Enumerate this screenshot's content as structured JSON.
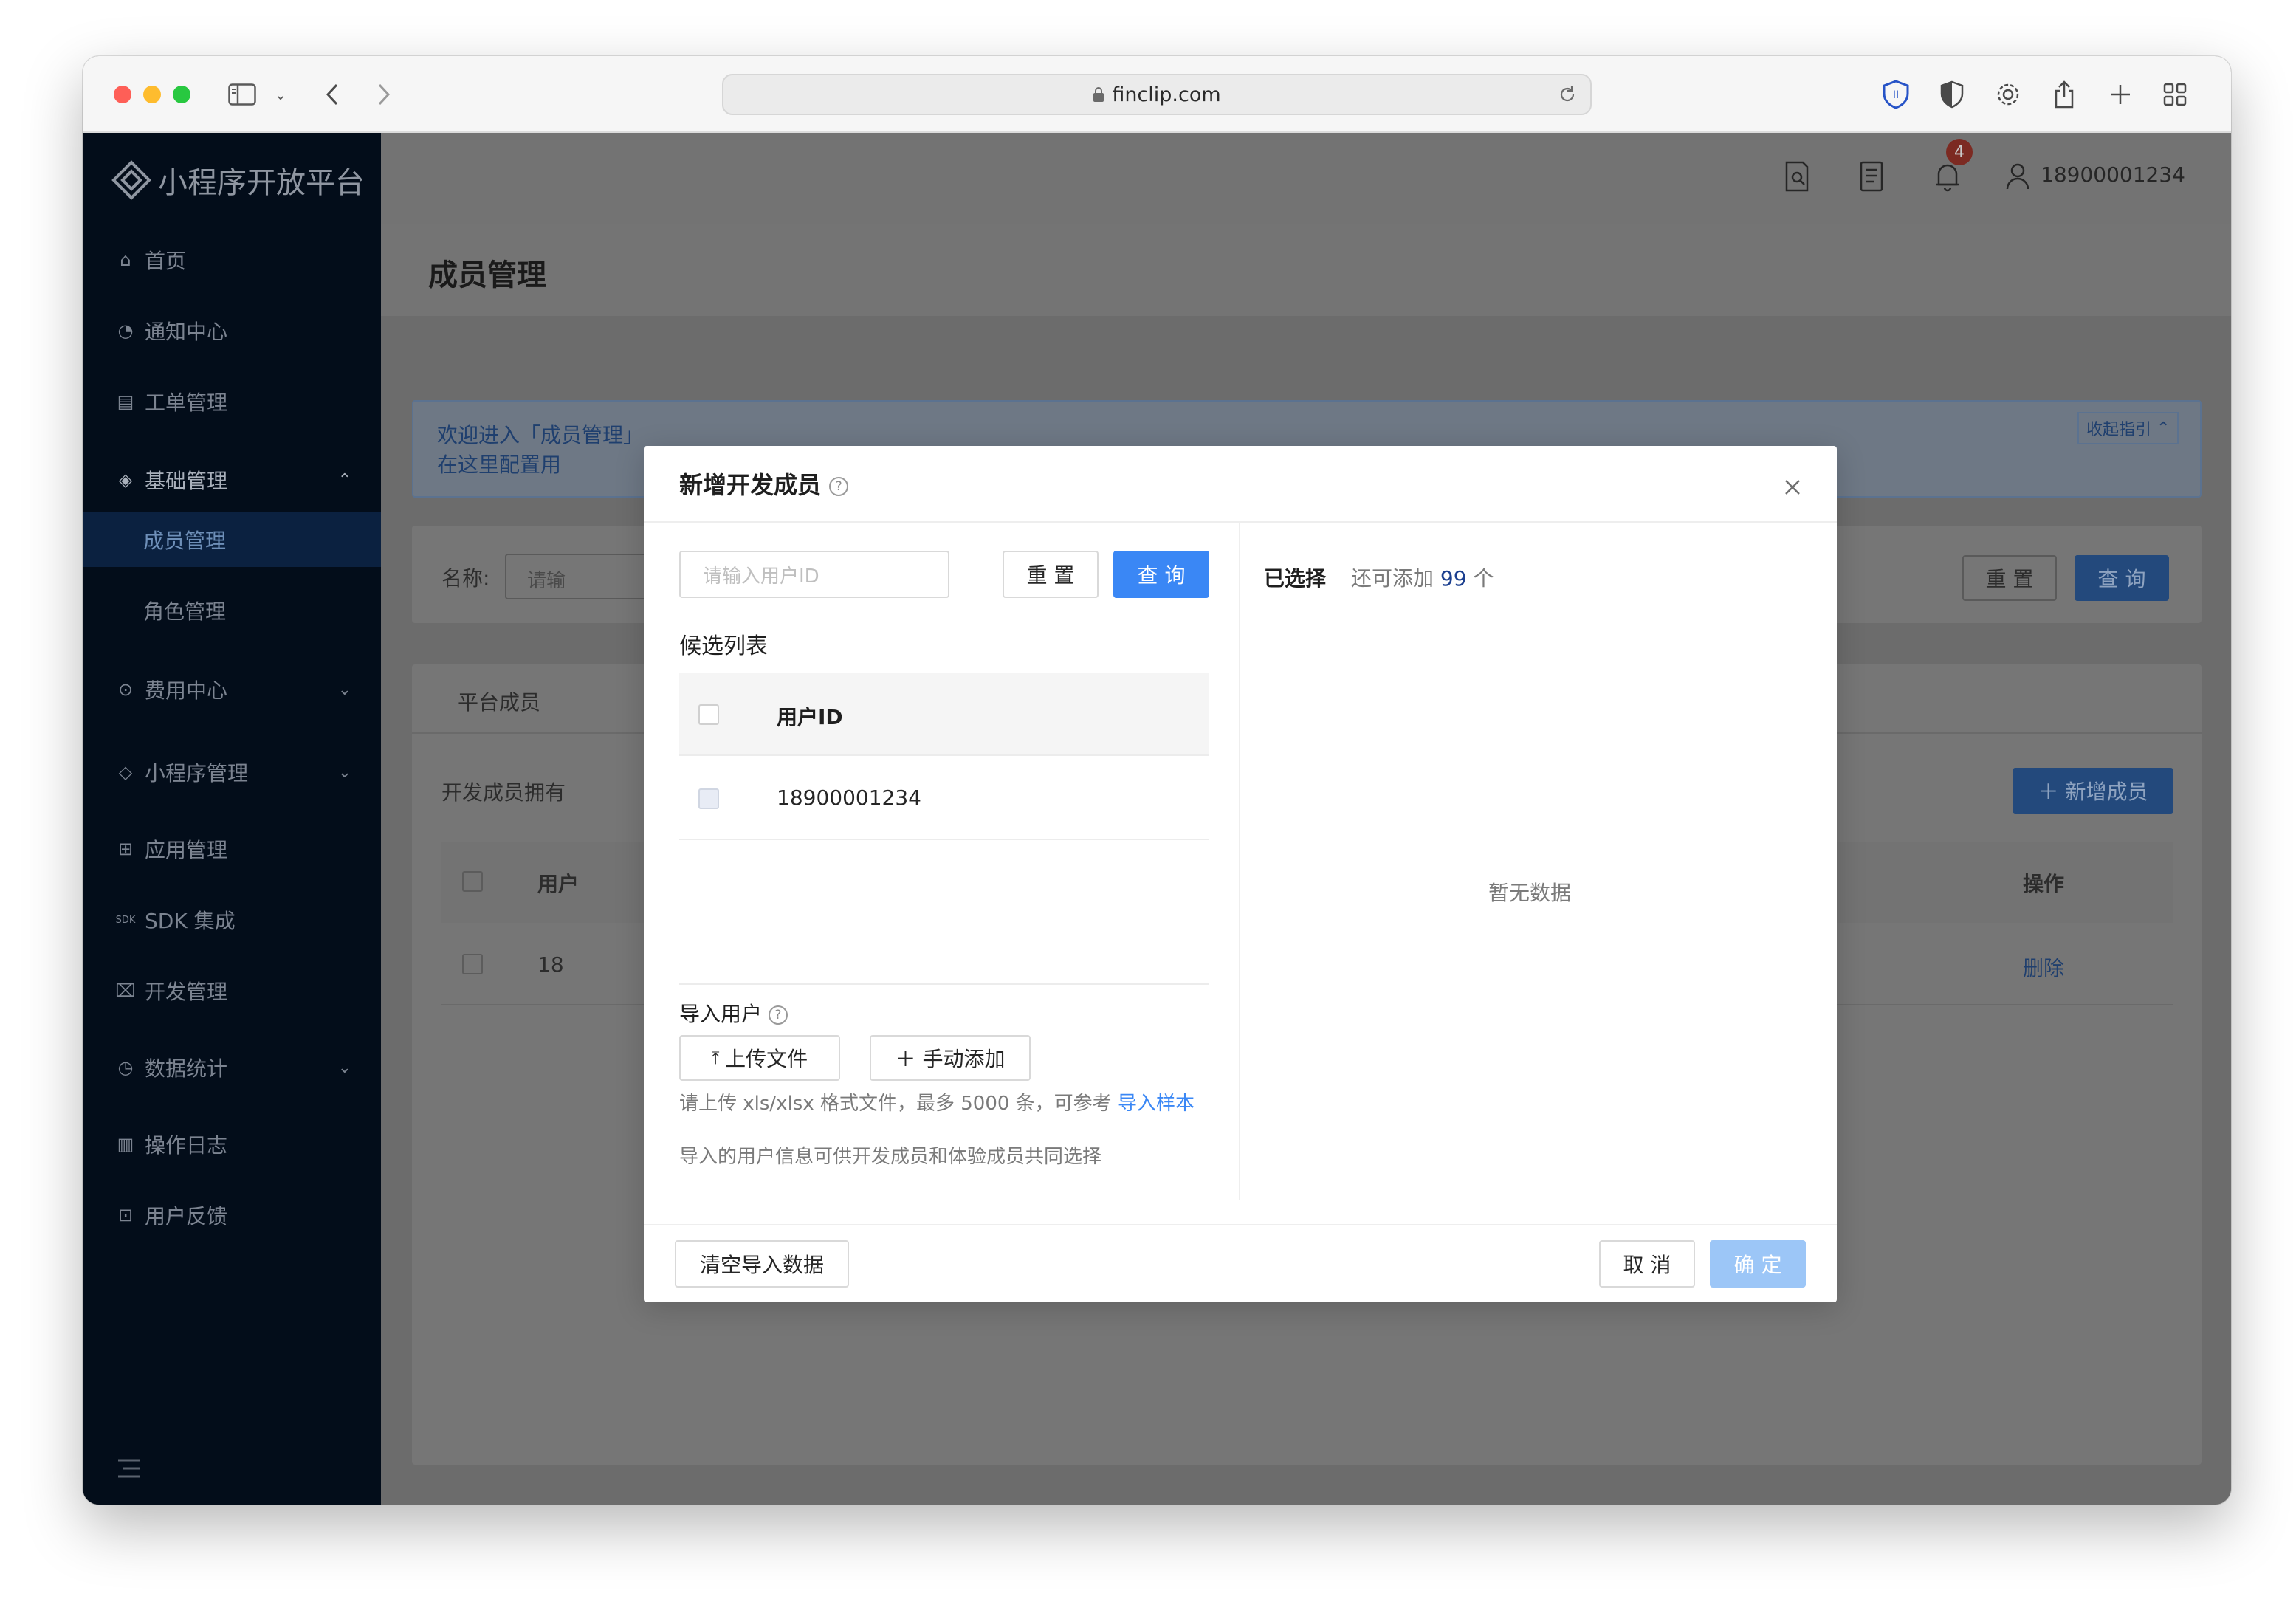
{
  "browser": {
    "url": "finclip.com"
  },
  "sidebar": {
    "logo_text": "小程序开放平台",
    "items": [
      {
        "label": "首页",
        "icon": "home-icon"
      },
      {
        "label": "通知中心",
        "icon": "bell-icon"
      },
      {
        "label": "工单管理",
        "icon": "ticket-icon"
      },
      {
        "label": "基础管理",
        "icon": "layers-icon"
      },
      {
        "label": "成员管理"
      },
      {
        "label": "角色管理"
      },
      {
        "label": "费用中心",
        "icon": "coin-icon"
      },
      {
        "label": "小程序管理",
        "icon": "diamond-icon"
      },
      {
        "label": "应用管理",
        "icon": "grid-icon"
      },
      {
        "label": "SDK 集成",
        "icon": "sdk-icon"
      },
      {
        "label": "开发管理",
        "icon": "code-icon"
      },
      {
        "label": "数据统计",
        "icon": "pie-icon"
      },
      {
        "label": "操作日志",
        "icon": "log-icon"
      },
      {
        "label": "用户反馈",
        "icon": "feedback-icon"
      }
    ]
  },
  "topbar": {
    "notification_count": "4",
    "username": "18900001234"
  },
  "page": {
    "title": "成员管理",
    "banner_line1": "欢迎进入「成员管理」",
    "banner_line2": "在这里配置用",
    "collapse_guide": "收起指引",
    "filter_label": "名称:",
    "filter_placeholder": "请输",
    "reset": "重 置",
    "query": "查 询",
    "tab_platform": "平台成员",
    "dev_desc": "开发成员拥有",
    "add_member": "新增成员",
    "col_user": "用户",
    "col_action": "操作",
    "row_user": "18",
    "row_delete": "删除"
  },
  "modal": {
    "title": "新增开发成员",
    "search_placeholder": "请输入用户ID",
    "reset": "重 置",
    "query": "查 询",
    "candidate_title": "候选列表",
    "col_user_id": "用户ID",
    "rows": [
      "18900001234"
    ],
    "import_title": "导入用户",
    "upload_file": "上传文件",
    "manual_add": "手动添加",
    "hint_prefix": "请上传 xls/xlsx 格式文件，最多 5000 条，可参考",
    "hint_link": "导入样本",
    "hint_line2": "导入的用户信息可供开发成员和体验成员共同选择",
    "selected_label": "已选择",
    "can_add_prefix": "还可添加",
    "can_add_count": "99",
    "can_add_suffix": "个",
    "empty": "暂无数据",
    "clear_import": "清空导入数据",
    "cancel": "取 消",
    "confirm": "确 定"
  }
}
